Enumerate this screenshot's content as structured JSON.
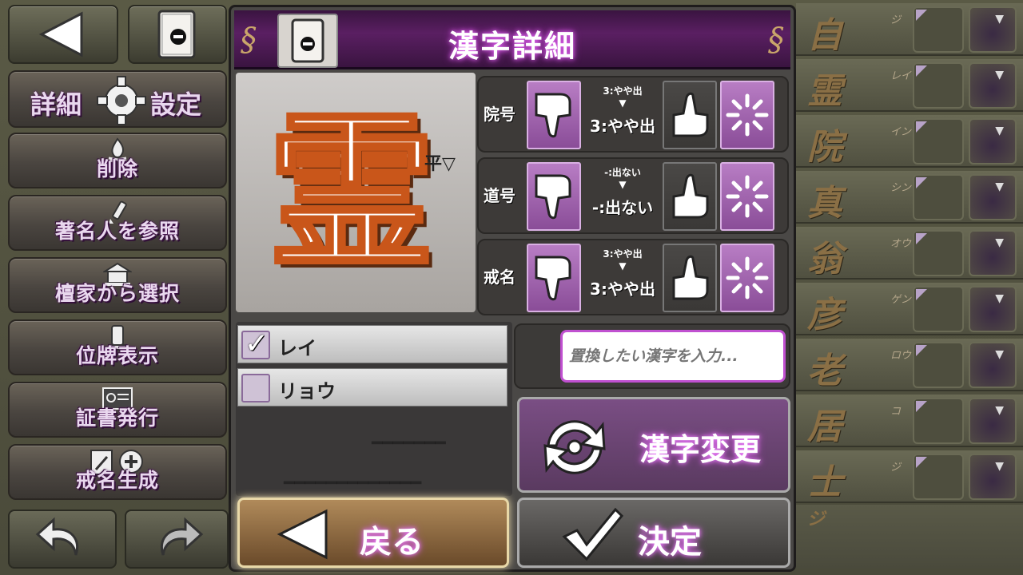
{
  "sidebar": {
    "detail_settings": {
      "left": "詳細",
      "right": "設定"
    },
    "items": [
      {
        "label": "削除",
        "icon": "fire-icon"
      },
      {
        "label": "著名人を参照",
        "icon": "brush-icon"
      },
      {
        "label": "檀家から選択",
        "icon": "temple-icon"
      },
      {
        "label": "位牌表示",
        "icon": "ihai-icon"
      },
      {
        "label": "証書発行",
        "icon": "certificate-icon"
      },
      {
        "label": "戒名生成",
        "icon": "edit-add-icon"
      }
    ]
  },
  "modal": {
    "title": "漢字詳細",
    "kanji": "霊",
    "tone": "平▽",
    "preferences": [
      {
        "label": "院号",
        "prev": "3:やや出",
        "current": "3:やや出"
      },
      {
        "label": "道号",
        "prev": "-:出ない",
        "current": "-:出ない"
      },
      {
        "label": "戒名",
        "prev": "3:やや出",
        "current": "3:やや出"
      }
    ],
    "readings": [
      {
        "text": "レイ",
        "checked": true
      },
      {
        "text": "リョウ",
        "checked": false
      }
    ],
    "replace_placeholder": "置換したい漢字を入力...",
    "change_label": "漢字変更",
    "back_label": "戻る",
    "ok_label": "決定"
  },
  "kanji_list": [
    {
      "char": "自",
      "reading": "ジ"
    },
    {
      "char": "霊",
      "reading": "レイ"
    },
    {
      "char": "院",
      "reading": "イン"
    },
    {
      "char": "真",
      "reading": "シン"
    },
    {
      "char": "翁",
      "reading": "オウ"
    },
    {
      "char": "彦",
      "reading": "ゲン"
    },
    {
      "char": "老",
      "reading": "ロウ"
    },
    {
      "char": "居",
      "reading": "コ"
    },
    {
      "char": "士",
      "reading": "ジ"
    }
  ],
  "kanji_list_footer": "ジ",
  "colors": {
    "accent": "#c050d0",
    "title_glow": "#e066f0",
    "kanji_stroke": "#c9561a"
  }
}
